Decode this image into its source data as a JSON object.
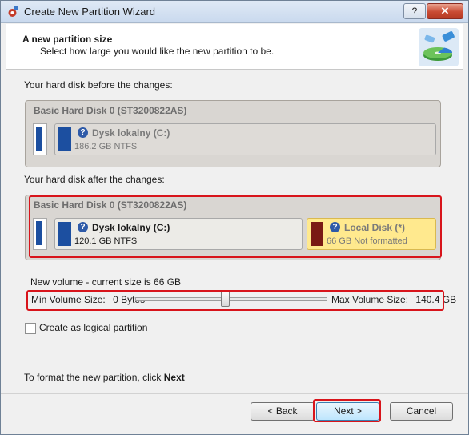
{
  "window": {
    "title": "Create New Partition Wizard",
    "help_label": "?",
    "close_label": "✕"
  },
  "header": {
    "title": "A new partition size",
    "subtitle": "Select how large you would like the new partition to be."
  },
  "before": {
    "label": "Your hard disk before the changes:",
    "disk_name": "Basic Hard Disk 0 (ST3200822AS)",
    "partition": {
      "name": "Dysk lokalny (C:)",
      "size": "186.2 GB NTFS"
    }
  },
  "after": {
    "label": "Your hard disk after the changes:",
    "disk_name": "Basic Hard Disk 0 (ST3200822AS)",
    "partition_c": {
      "name": "Dysk lokalny (C:)",
      "size": "120.1 GB NTFS"
    },
    "partition_new": {
      "name": "Local Disk (*)",
      "size": "66 GB Not formatted"
    }
  },
  "volume": {
    "label": "New volume - current size is 66 GB",
    "min_label": "Min Volume Size:",
    "min_value": "0 Bytes",
    "max_label": "Max Volume Size:",
    "max_value": "140.4 GB",
    "slider_fraction": 0.47
  },
  "logical": {
    "label": "Create as logical partition",
    "checked": false
  },
  "footer": {
    "hint_prefix": "To format the new partition, click ",
    "hint_bold": "Next"
  },
  "buttons": {
    "back": "< Back",
    "next": "Next >",
    "cancel": "Cancel"
  },
  "colors": {
    "highlight_red": "#d8141b",
    "partition_blue": "#1c4fa0",
    "new_partition_swatch": "#7a1a14",
    "new_partition_bg": "#ffe98e"
  }
}
